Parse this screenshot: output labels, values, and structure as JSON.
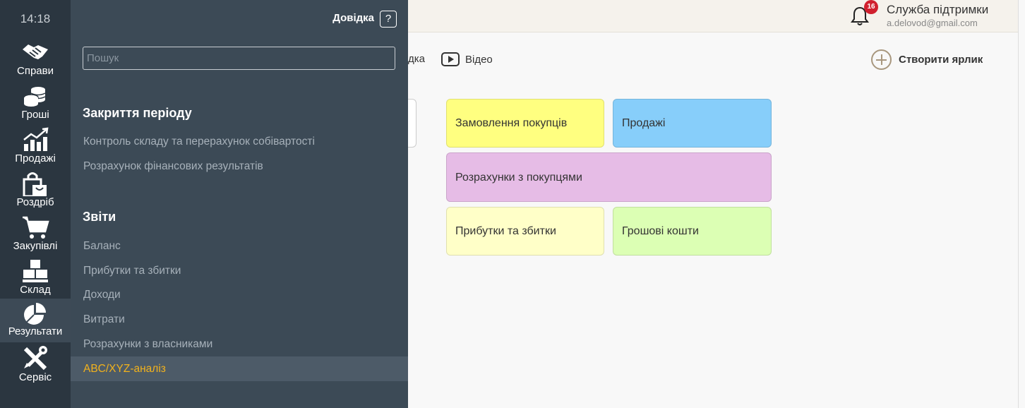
{
  "sidebar": {
    "clock": "14:18",
    "items": [
      {
        "label": "Справи",
        "icon": "handshake-icon"
      },
      {
        "label": "Гроші",
        "icon": "coins-icon"
      },
      {
        "label": "Продажі",
        "icon": "sales-chart-icon"
      },
      {
        "label": "Роздріб",
        "icon": "shopping-bag-icon"
      },
      {
        "label": "Закупівлі",
        "icon": "cart-icon"
      },
      {
        "label": "Склад",
        "icon": "boxes-icon"
      },
      {
        "label": "Результати",
        "icon": "pie-chart-icon"
      },
      {
        "label": "Сервіс",
        "icon": "tools-icon"
      }
    ]
  },
  "header": {
    "notifications_count": "16",
    "support_name": "Служба підтримки",
    "support_email": "a.delovod@gmail.com"
  },
  "toolbar": {
    "help_partial": "дка",
    "video_label": "Відео",
    "create_shortcut_label": "Створити ярлик"
  },
  "tiles": [
    {
      "label": "Замовлення покупців",
      "color": "#ffff80"
    },
    {
      "label": "Продажі",
      "color": "#87cefa"
    },
    {
      "label": "Розрахунки з покупцями",
      "color": "#e6bce6"
    },
    {
      "label": "Прибутки та збитки",
      "color": "#ffffc8"
    },
    {
      "label": "Грошові кошти",
      "color": "#dcffb4"
    }
  ],
  "menu": {
    "help_label": "Довідка",
    "help_icon_text": "?",
    "search_placeholder": "Пошук",
    "sections": [
      {
        "title": "Закриття періоду",
        "items": [
          "Контроль складу та перерахунок собівартості",
          "Розрахунок фінансових результатів"
        ]
      },
      {
        "title": "Звіти",
        "items": [
          "Баланс",
          "Прибутки та збитки",
          "Доходи",
          "Витрати",
          "Розрахунки з власниками",
          "ABC/XYZ-аналіз"
        ]
      }
    ],
    "selected_item": "ABC/XYZ-аналіз",
    "selected_color": "#f2b21c"
  }
}
